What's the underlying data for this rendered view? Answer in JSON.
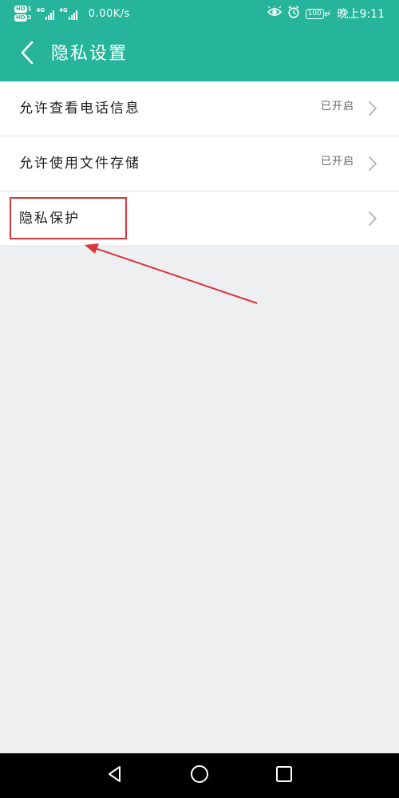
{
  "status_bar": {
    "hd1": "HD",
    "hd1_sub": "1",
    "hd2": "HD",
    "hd2_sub": "2",
    "net1": "4G",
    "net2": "4G",
    "speed": "0.00K/s",
    "battery": "100",
    "time": "晚上9:11",
    "icons": [
      "eye-icon",
      "alarm-icon",
      "battery-icon",
      "charging-icon"
    ]
  },
  "header": {
    "title": "隐私设置",
    "back_icon": "chevron-left-icon",
    "background": "#26b59b"
  },
  "settings": {
    "items": [
      {
        "label": "允许查看电话信息",
        "status": "已开启"
      },
      {
        "label": "允许使用文件存储",
        "status": "已开启"
      },
      {
        "label": "隐私保护",
        "status": ""
      }
    ]
  },
  "annotation": {
    "color": "#d9363e"
  },
  "nav_bar": {
    "icons": [
      "back-triangle-icon",
      "home-circle-icon",
      "recents-square-icon"
    ]
  }
}
